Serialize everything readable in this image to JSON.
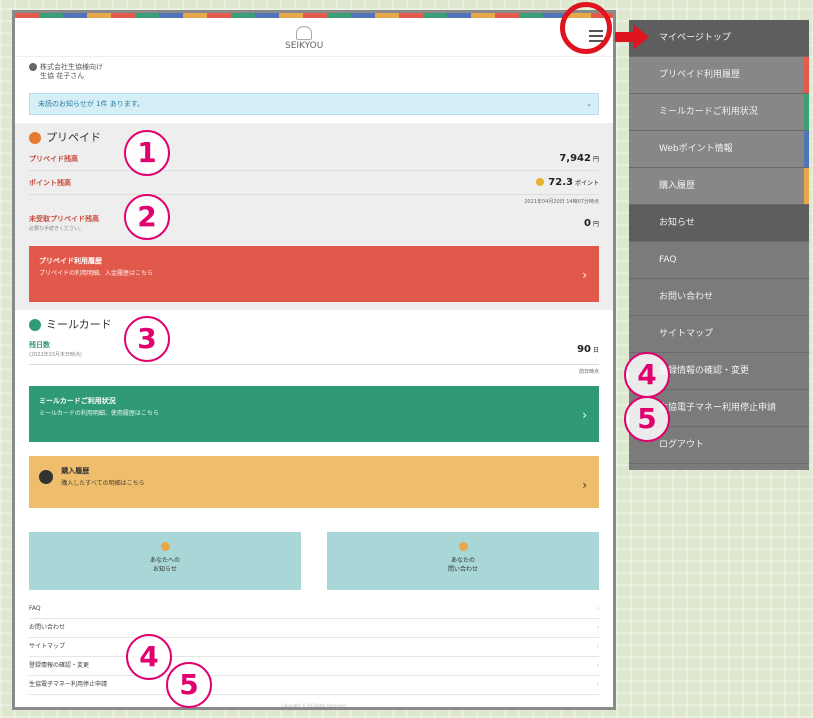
{
  "app": {
    "logo_text": "SEIKYOU"
  },
  "user": {
    "company": "株式会社生協様向け",
    "name": "生協 花子さん"
  },
  "notice": {
    "text": "未読のお知らせが 1件 あります。",
    "caret": "⌄"
  },
  "prepaid": {
    "title": "プリペイド",
    "balance_label": "プリペイド残高",
    "balance_value": "7,942",
    "balance_unit": "円",
    "points_label": "ポイント残高",
    "points_value": "72.3",
    "points_unit": "ポイント",
    "updated": "2021年04月20日 14時07分時点",
    "unconfirmed_label": "未受取プリペイド残高",
    "unconfirmed_sub": "必要な手続きください。",
    "unconfirmed_value": "0",
    "unconfirmed_unit": "円",
    "history_title": "プリペイド利用履歴",
    "history_sub": "プリペイドの利用明細、入金履歴はこちら"
  },
  "meal": {
    "title": "ミールカード",
    "remaining_label": "残日数",
    "remaining_sub": "(2022年03月末日時点)",
    "remaining_value": "90",
    "remaining_unit": "日",
    "updated": "前日時点",
    "usage_title": "ミールカードご利用状況",
    "usage_sub": "ミールカードの利用明細、使用履歴はこちら"
  },
  "purchase": {
    "title": "購入履歴",
    "sub": "購入したすべての明細はこちら"
  },
  "tiles": [
    {
      "line1": "あなたへの",
      "line2": "お知らせ"
    },
    {
      "line1": "あなたの",
      "line2": "問い合わせ"
    }
  ],
  "links": [
    "FAQ",
    "お問い合わせ",
    "サイトマップ",
    "登録情報の確認・変更",
    "生協電子マネー利用停止申請"
  ],
  "footer": "Copyright ©  All Rights Reserved.",
  "menu": [
    {
      "label": "マイページトップ",
      "bar": ""
    },
    {
      "label": "プリペイド利用履歴",
      "bar": "#e45a4b"
    },
    {
      "label": "ミールカードご利用状況",
      "bar": "#3a9e76"
    },
    {
      "label": "Webポイント情報",
      "bar": "#4f74b8"
    },
    {
      "label": "購入履歴",
      "bar": "#e6a84a"
    },
    {
      "label": "お知らせ",
      "bar": ""
    },
    {
      "label": "FAQ",
      "bar": ""
    },
    {
      "label": "お問い合わせ",
      "bar": ""
    },
    {
      "label": "サイトマップ",
      "bar": ""
    },
    {
      "label": "登録情報の確認・変更",
      "bar": ""
    },
    {
      "label": "生協電子マネー利用停止申請",
      "bar": ""
    },
    {
      "label": "ログアウト",
      "bar": ""
    }
  ],
  "badges": [
    "1",
    "2",
    "3",
    "4",
    "5",
    "4",
    "5"
  ],
  "chevron": "›",
  "colors": {
    "accent_red": "#e1594a",
    "accent_green": "#2f9a74",
    "accent_orange": "#efbe6c",
    "annotation": "#e0006e"
  }
}
